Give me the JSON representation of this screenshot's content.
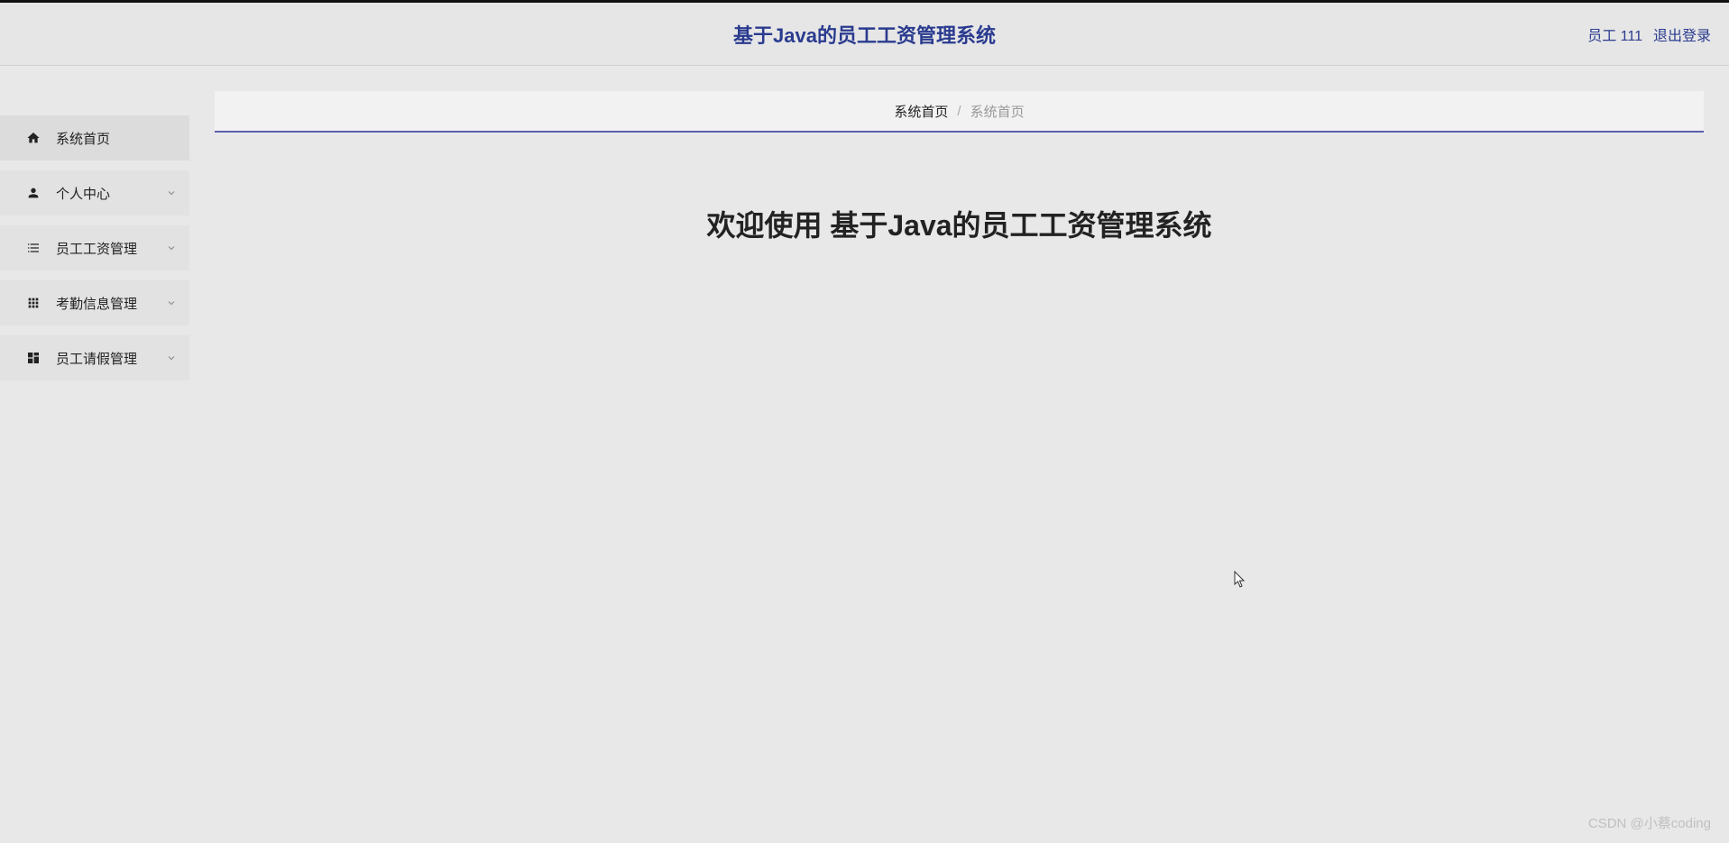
{
  "header": {
    "title": "基于Java的员工工资管理系统",
    "user_label": "员工 111",
    "logout_label": "退出登录"
  },
  "sidebar": {
    "items": [
      {
        "icon": "home",
        "label": "系统首页",
        "active": true,
        "expandable": false
      },
      {
        "icon": "person",
        "label": "个人中心",
        "active": false,
        "expandable": true
      },
      {
        "icon": "list",
        "label": "员工工资管理",
        "active": false,
        "expandable": true
      },
      {
        "icon": "grid",
        "label": "考勤信息管理",
        "active": false,
        "expandable": true
      },
      {
        "icon": "dashboard",
        "label": "员工请假管理",
        "active": false,
        "expandable": true
      }
    ]
  },
  "breadcrumb": {
    "root": "系统首页",
    "separator": "/",
    "current": "系统首页"
  },
  "main": {
    "welcome_text": "欢迎使用 基于Java的员工工资管理系统"
  },
  "watermark": "CSDN @小蔡coding"
}
